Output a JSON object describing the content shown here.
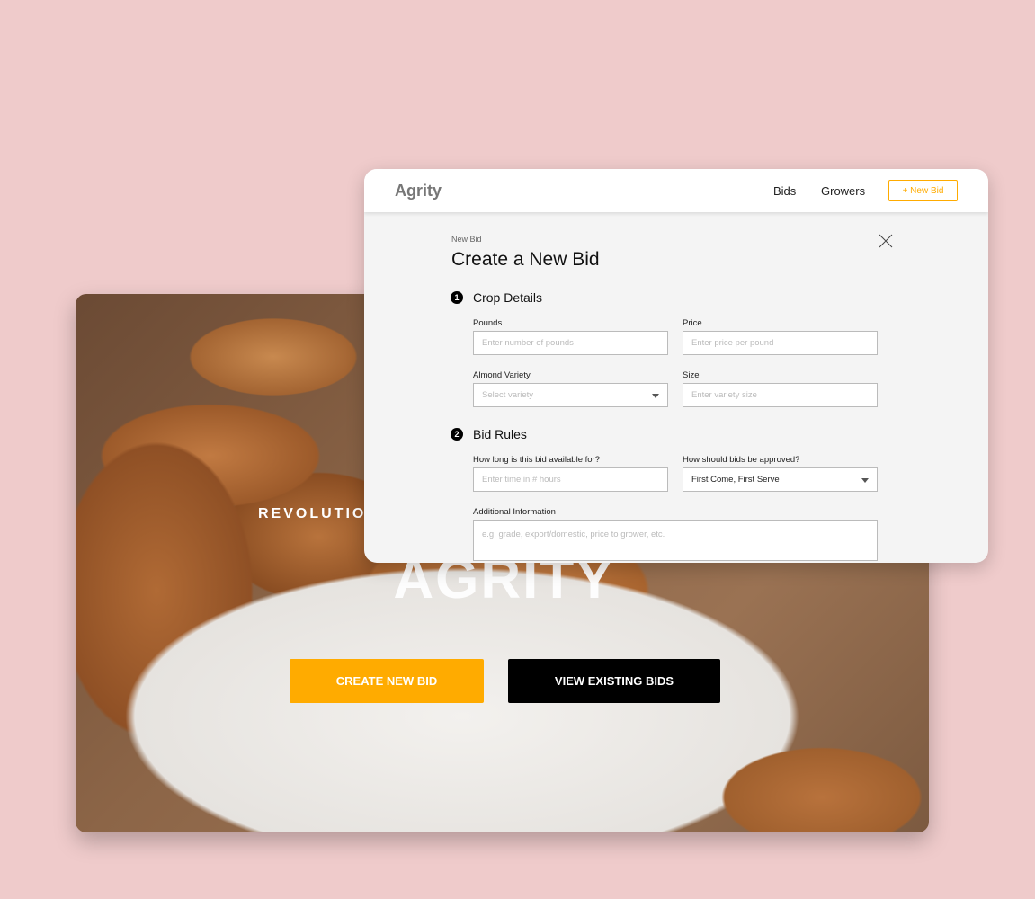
{
  "hero": {
    "tagline": "REVOLUTIO",
    "title": "AGRITY",
    "create_button": "CREATE NEW BID",
    "view_button": "VIEW EXISTING BIDS"
  },
  "nav": {
    "logo": "Agrity",
    "links": [
      "Bids",
      "Growers"
    ],
    "new_bid_button": "+ New Bid"
  },
  "form": {
    "breadcrumb": "New Bid",
    "title": "Create a New Bid",
    "sections": [
      {
        "number": "1",
        "title": "Crop Details"
      },
      {
        "number": "2",
        "title": "Bid Rules"
      }
    ],
    "fields": {
      "pounds": {
        "label": "Pounds",
        "placeholder": "Enter number of pounds"
      },
      "price": {
        "label": "Price",
        "placeholder": "Enter price per pound"
      },
      "variety": {
        "label": "Almond Variety",
        "placeholder": "Select variety"
      },
      "size": {
        "label": "Size",
        "placeholder": "Enter variety size"
      },
      "duration": {
        "label": "How long is this bid available for?",
        "placeholder": "Enter time in # hours"
      },
      "approval": {
        "label": "How should bids be approved?",
        "value": "First Come, First Serve"
      },
      "additional": {
        "label": "Additional Information",
        "placeholder": "e.g. grade, export/domestic, price to grower, etc."
      }
    }
  },
  "colors": {
    "accent": "#ffab00",
    "background": "#efcbcb"
  }
}
